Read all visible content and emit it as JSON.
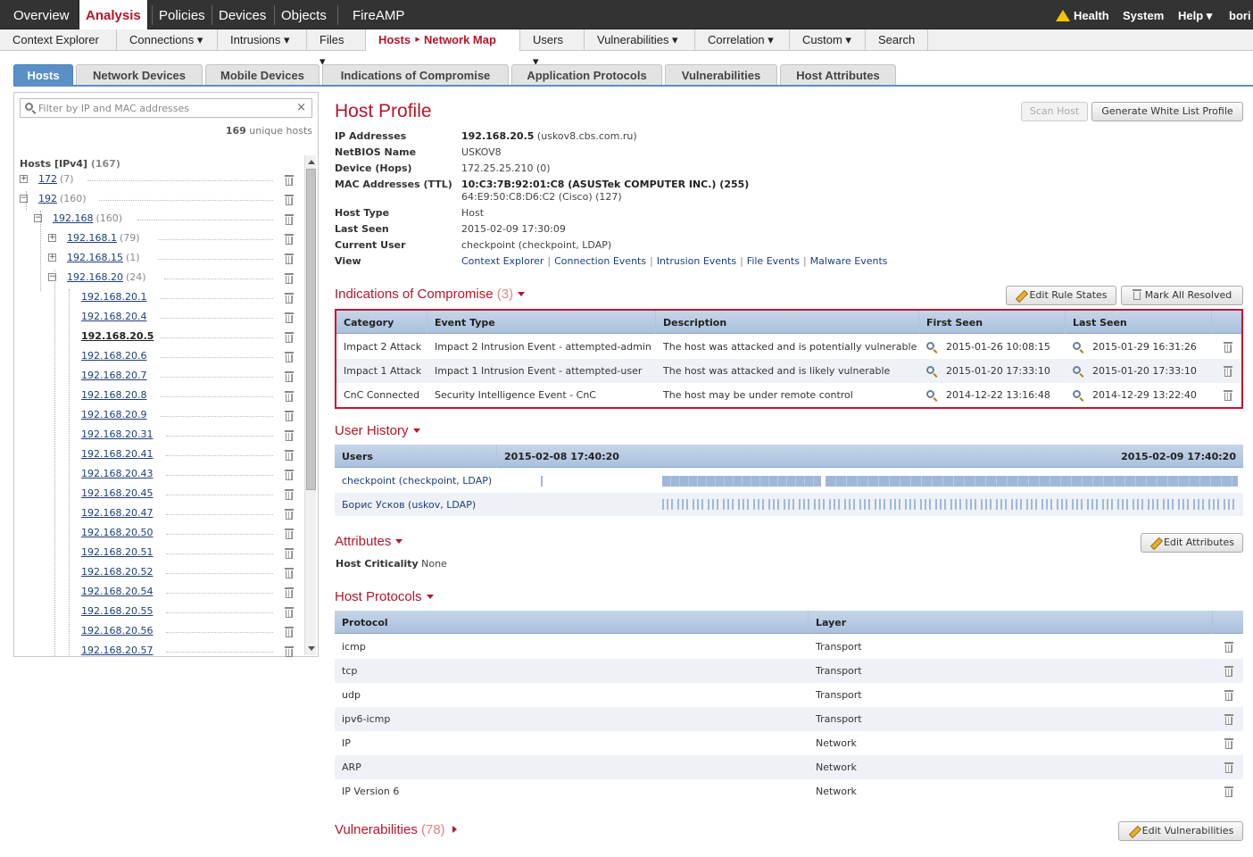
{
  "topnav": {
    "items": [
      "Overview",
      "Analysis",
      "Policies",
      "Devices",
      "Objects",
      "FireAMP"
    ],
    "health": "Health",
    "system": "System",
    "help": "Help ▾",
    "user": "bori"
  },
  "subnav": {
    "items": [
      "Context Explorer",
      "Connections ▾",
      "Intrusions ▾",
      "Files ▾",
      "Hosts ‣ Network Map",
      "Users ▾",
      "Vulnerabilities ▾",
      "Correlation ▾",
      "Custom ▾",
      "Search"
    ]
  },
  "tabs": [
    "Hosts",
    "Network Devices",
    "Mobile Devices",
    "Indications of Compromise",
    "Application Protocols",
    "Vulnerabilities",
    "Host Attributes"
  ],
  "left": {
    "filter_placeholder": "Filter by IP and MAC addresses",
    "clear": "×",
    "unique_count": "169",
    "unique_label": "unique hosts",
    "tree_title": "Hosts [IPv4]",
    "tree_count": "(167)",
    "nodes": [
      {
        "label": "172",
        "count": "(7)"
      },
      {
        "label": "192",
        "count": "(160)"
      },
      {
        "label": "192.168",
        "count": "(160)"
      },
      {
        "label": "192.168.1",
        "count": "(79)"
      },
      {
        "label": "192.168.15",
        "count": "(1)"
      },
      {
        "label": "192.168.20",
        "count": "(24)"
      },
      {
        "label": "192.168.20.1",
        "count": ""
      },
      {
        "label": "192.168.20.4",
        "count": ""
      },
      {
        "label": "192.168.20.5",
        "count": ""
      },
      {
        "label": "192.168.20.6",
        "count": ""
      },
      {
        "label": "192.168.20.7",
        "count": ""
      },
      {
        "label": "192.168.20.8",
        "count": ""
      },
      {
        "label": "192.168.20.9",
        "count": ""
      },
      {
        "label": "192.168.20.31",
        "count": ""
      },
      {
        "label": "192.168.20.41",
        "count": ""
      },
      {
        "label": "192.168.20.43",
        "count": ""
      },
      {
        "label": "192.168.20.45",
        "count": ""
      },
      {
        "label": "192.168.20.47",
        "count": ""
      },
      {
        "label": "192.168.20.50",
        "count": ""
      },
      {
        "label": "192.168.20.51",
        "count": ""
      },
      {
        "label": "192.168.20.52",
        "count": ""
      },
      {
        "label": "192.168.20.54",
        "count": ""
      },
      {
        "label": "192.168.20.55",
        "count": ""
      },
      {
        "label": "192.168.20.56",
        "count": ""
      },
      {
        "label": "192.168.20.57",
        "count": ""
      }
    ]
  },
  "profile": {
    "title": "Host Profile",
    "scan_host": "Scan Host",
    "gen_whitelist": "Generate White List Profile",
    "fields": {
      "ip_label": "IP Addresses",
      "ip_value": "192.168.20.5",
      "ip_host": "(uskov8.cbs.com.ru)",
      "netbios_label": "NetBIOS Name",
      "netbios_value": "USKOV8",
      "device_label": "Device (Hops)",
      "device_value": "172.25.25.210 (0)",
      "mac_label": "MAC Addresses (TTL)",
      "mac_value1": "10:C3:7B:92:01:C8 (ASUSTek COMPUTER INC.) (255)",
      "mac_value2": "64:E9:50:C8:D6:C2 (Cisco) (127)",
      "hosttype_label": "Host Type",
      "hosttype_value": "Host",
      "lastseen_label": "Last Seen",
      "lastseen_value": "2015-02-09 17:30:09",
      "user_label": "Current User",
      "user_value": "checkpoint (checkpoint, LDAP)",
      "view_label": "View",
      "view_links": [
        "Context Explorer",
        "Connection Events",
        "Intrusion Events",
        "File Events",
        "Malware Events"
      ]
    }
  },
  "ioc": {
    "title": "Indications of Compromise",
    "count": "(3)",
    "edit_rule_states": "Edit Rule States",
    "mark_all_resolved": "Mark All Resolved",
    "columns": [
      "Category",
      "Event Type",
      "Description",
      "First Seen",
      "Last Seen"
    ],
    "rows": [
      {
        "category": "Impact 2 Attack",
        "event": "Impact 2 Intrusion Event - attempted-admin",
        "desc": "The host was attacked and is potentially vulnerable",
        "first": "2015-01-26 10:08:15",
        "last": "2015-01-29 16:31:26"
      },
      {
        "category": "Impact 1 Attack",
        "event": "Impact 1 Intrusion Event - attempted-user",
        "desc": "The host was attacked and is likely vulnerable",
        "first": "2015-01-20 17:33:10",
        "last": "2015-01-20 17:33:10"
      },
      {
        "category": "CnC Connected",
        "event": "Security Intelligence Event - CnC",
        "desc": "The host may be under remote control",
        "first": "2014-12-22 13:16:48",
        "last": "2014-12-29 13:22:40"
      }
    ]
  },
  "user_history": {
    "title": "User History",
    "col_users": "Users",
    "start": "2015-02-08 17:40:20",
    "end": "2015-02-09 17:40:20",
    "users": [
      "checkpoint (checkpoint, LDAP)",
      "Борис Усков (uskov, LDAP)"
    ]
  },
  "attributes": {
    "title": "Attributes",
    "edit": "Edit Attributes",
    "criticality_label": "Host Criticality",
    "criticality_value": "None"
  },
  "protocols": {
    "title": "Host Protocols",
    "columns": [
      "Protocol",
      "Layer"
    ],
    "rows": [
      {
        "protocol": "icmp",
        "layer": "Transport"
      },
      {
        "protocol": "tcp",
        "layer": "Transport"
      },
      {
        "protocol": "udp",
        "layer": "Transport"
      },
      {
        "protocol": "ipv6-icmp",
        "layer": "Transport"
      },
      {
        "protocol": "IP",
        "layer": "Network"
      },
      {
        "protocol": "ARP",
        "layer": "Network"
      },
      {
        "protocol": "IP Version 6",
        "layer": "Network"
      }
    ]
  },
  "vulns": {
    "title": "Vulnerabilities",
    "count": "(78)",
    "edit": "Edit Vulnerabilities"
  },
  "colors": {
    "accent_red": "#b5162b",
    "header_blue": "#5b8fc7",
    "timeline_blue": "#9fb8da"
  }
}
